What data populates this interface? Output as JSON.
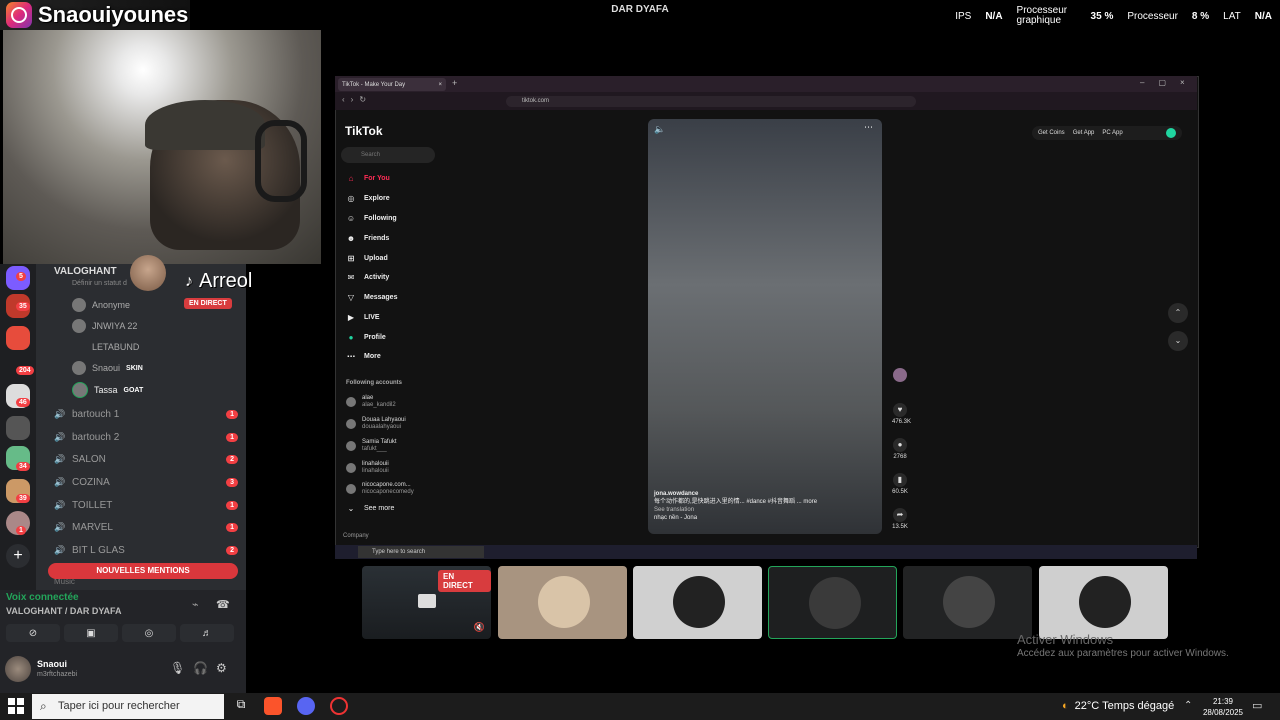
{
  "streamer": {
    "name": "Snaouiyounes"
  },
  "server_title": "DAR DYAFA",
  "perf": {
    "ips_label": "IPS",
    "ips_value": "N/A",
    "gpu_label": "Processeur graphique",
    "gpu_value": "35 %",
    "cpu_label": "Processeur",
    "cpu_value": "8 %",
    "lat_label": "LAT",
    "lat_value": "N/A"
  },
  "discord": {
    "server_badges": [
      "5",
      "35",
      "204",
      "46",
      "34",
      "39",
      "1"
    ],
    "voice_channel": "VALOGHANT",
    "voice_status_hint": "Définir un statut d",
    "overlay_user": "Arreol",
    "members": [
      {
        "name": "Anonyme",
        "tag": ""
      },
      {
        "name": "JNWIYA 22",
        "tag": ""
      },
      {
        "name": "LETABUND",
        "tag": ""
      },
      {
        "name": "Snaoui",
        "tag": "SKIN"
      },
      {
        "name": "Tassa",
        "tag": "GOAT"
      }
    ],
    "live_label": "EN DIRECT",
    "channels": [
      {
        "name": "bartouch 1",
        "count": "1"
      },
      {
        "name": "bartouch 2",
        "count": "1"
      },
      {
        "name": "SALON",
        "count": "2"
      },
      {
        "name": "COZINA",
        "count": "3"
      },
      {
        "name": "TOILLET",
        "count": "1"
      },
      {
        "name": "MARVEL",
        "count": "1"
      },
      {
        "name": "BIT L GLAS",
        "count": "2"
      }
    ],
    "mentions_button": "NOUVELLES MENTIONS",
    "music_label": "Music",
    "voice_connected": "Voix connectée",
    "voice_location": "VALOGHANT / DAR DYAFA",
    "user_name": "Snaoui",
    "user_sub": "m3rftchazebi"
  },
  "browser": {
    "tab_title": "TikTok - Make Your Day",
    "url": "tiktok.com"
  },
  "tiktok": {
    "logo": "TikTok",
    "search_placeholder": "Search",
    "nav": [
      "For You",
      "Explore",
      "Following",
      "Friends",
      "Upload",
      "Activity",
      "Messages",
      "LIVE",
      "Profile",
      "More"
    ],
    "following_title": "Following accounts",
    "following": [
      {
        "name": "alae",
        "handle": "alae_kandil2"
      },
      {
        "name": "Douaa Lahyaoui",
        "handle": "douaalahyaoui"
      },
      {
        "name": "Samia Tafukt",
        "handle": "tafukt___"
      },
      {
        "name": "linahalouii",
        "handle": "linahalouii"
      },
      {
        "name": "nicocapone.com...",
        "handle": "nicocaponecomedy"
      }
    ],
    "see_more": "See more",
    "company": "Company",
    "video_author": "jona.wowdance",
    "video_caption": "每个动作都的,是快跳进入里的情... #dance #抖音舞蹈 ... more",
    "see_translation": "See translation",
    "music": "nhạc nền - Jona",
    "likes": "476.3K",
    "comments": "2768",
    "saves": "60.5K",
    "shares": "13.5K",
    "top_actions": [
      "Get Coins",
      "Get App",
      "PC App"
    ]
  },
  "taskbar_inner": {
    "search": "Type here to search"
  },
  "windows": {
    "activate_title": "Activer Windows",
    "activate_sub": "Accédez aux paramètres pour activer Windows.",
    "search": "Taper ici pour rechercher",
    "weather": "22°C  Temps dégagé",
    "time": "21:39",
    "date": "28/08/2025"
  }
}
